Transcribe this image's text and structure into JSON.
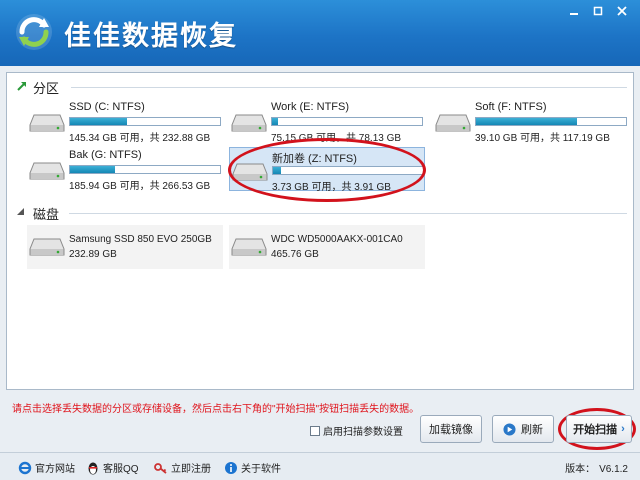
{
  "app": {
    "title": "佳佳数据恢复"
  },
  "partitions": {
    "label": "分区",
    "items": [
      {
        "name": "SSD (C: NTFS)",
        "size": "145.34 GB 可用，共 232.88 GB",
        "used_fraction": 0.38,
        "selected": false
      },
      {
        "name": "Work (E: NTFS)",
        "size": "75.15 GB 可用，共 78.13 GB",
        "used_fraction": 0.04,
        "selected": false
      },
      {
        "name": "Soft (F: NTFS)",
        "size": "39.10 GB 可用，共 117.19 GB",
        "used_fraction": 0.67,
        "selected": false
      },
      {
        "name": "Bak (G: NTFS)",
        "size": "185.94 GB 可用，共 266.53 GB",
        "used_fraction": 0.3,
        "selected": false
      },
      {
        "name": "新加卷 (Z: NTFS)",
        "size": "3.73 GB 可用，共 3.91 GB",
        "used_fraction": 0.05,
        "selected": true
      }
    ]
  },
  "disks": {
    "label": "磁盘",
    "items": [
      {
        "name": "Samsung SSD 850 EVO 250GB",
        "size": "232.89 GB"
      },
      {
        "name": "WDC WD5000AAKX-001CA0",
        "size": "465.76 GB"
      }
    ]
  },
  "hint": "请点击选择丢失数据的分区或存储设备，然后点击右下角的\"开始扫描\"按钮扫描丢失的数据。",
  "actions": {
    "scan_option": "启用扫描参数设置",
    "load_image": "加载镜像",
    "refresh": "刷新",
    "start_scan": "开始扫描"
  },
  "footer": {
    "links": [
      "官方网站",
      "客服QQ",
      "立即注册",
      "关于软件"
    ],
    "version_label": "版本：",
    "version": "V6.1.2"
  },
  "colors": {
    "titlebar": "#1d74c6",
    "accent": "#1487b5",
    "annotation": "#d2121c",
    "hint": "#e0141c"
  }
}
